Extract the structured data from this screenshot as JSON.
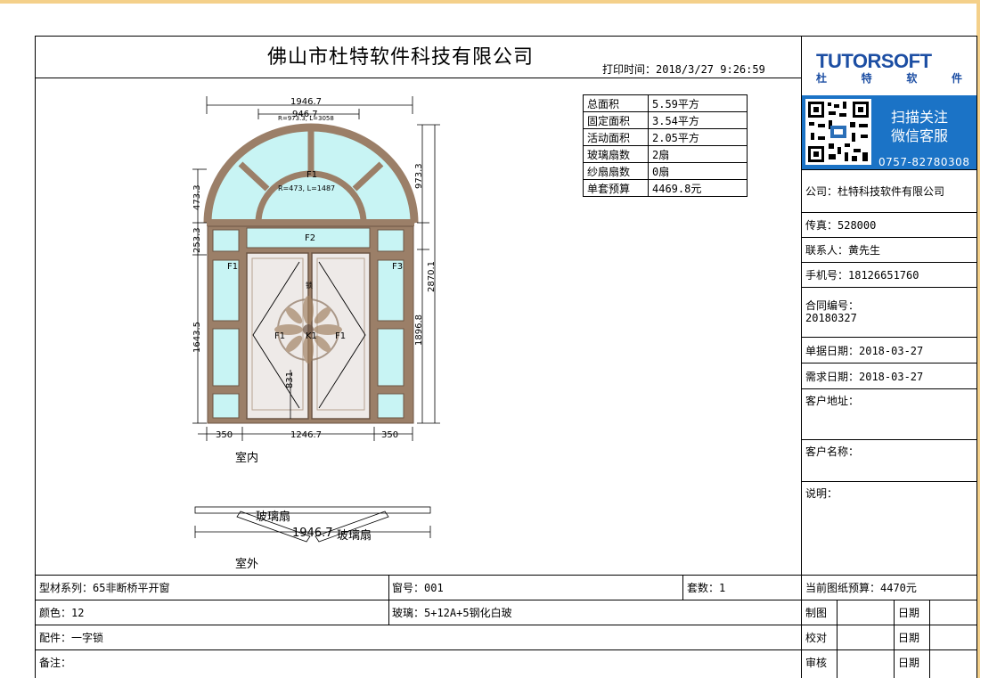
{
  "header": {
    "company_title": "佛山市杜特软件科技有限公司",
    "print_time": "打印时间：2018/3/27 9:26:59"
  },
  "logo": {
    "brand": "TUTORSOFT",
    "cn_chars": [
      "杜",
      "特",
      "软",
      "件"
    ]
  },
  "qr_panel": {
    "line1": "扫描关注",
    "line2": "微信客服",
    "phone": "0757-82780308"
  },
  "stats": [
    {
      "label": "总面积",
      "value": "5.59平方"
    },
    {
      "label": "固定面积",
      "value": "3.54平方"
    },
    {
      "label": "活动面积",
      "value": "2.05平方"
    },
    {
      "label": "玻璃扇数",
      "value": "2扇"
    },
    {
      "label": "纱扇扇数",
      "value": "0扇"
    },
    {
      "label": "单套预算",
      "value": "4469.8元"
    }
  ],
  "info": {
    "company": "公司：杜特科技软件有限公司",
    "fax": "传真：528000",
    "contact": "联系人：黄先生",
    "mobile": "手机号：18126651760",
    "contract_label": "合同编号：",
    "contract_no": "20180327",
    "doc_date": "单据日期：2018-03-27",
    "need_date": "需求日期：2018-03-27",
    "address": "客户地址：",
    "customer": "客户名称：",
    "notes": "说明："
  },
  "drawing": {
    "dim_top": "1946.7",
    "dim_top_inner": "946.7",
    "arc_label_outer": "R=973.3, L=3058",
    "arc_label_inner": "R=473, L=1487",
    "f1_top": "F1",
    "f2": "F2",
    "f1_left": "F1",
    "f3_right": "F3",
    "f1_leaf_left": "F1",
    "f1_leaf_right": "F1",
    "k1": "K1",
    "lock": "锁",
    "h_left_1": "473.3",
    "h_left_2": "253.3",
    "h_left_3": "1643.5",
    "h_right_1": "973.3",
    "h_right_2": "2870.1",
    "h_right_3": "1896.8",
    "handle_h": "831",
    "dim_b1": "350",
    "dim_b2": "1246.7",
    "dim_b3": "350",
    "indoor": "室内",
    "outdoor": "室外",
    "plan_dim": "1946.7",
    "plan_leaf_1": "玻璃扇",
    "plan_leaf_2": "玻璃扇"
  },
  "footer": {
    "series": "型材系列：65非断桥平开窗",
    "window_no": "窗号：001",
    "sets": "套数：1",
    "budget": "当前图纸预算：4470元",
    "color": "颜色：12",
    "glass": "玻璃：5+12A+5钢化白玻",
    "accessory": "配件：一字锁",
    "remark": "备注：",
    "draw": "制图",
    "check": "校对",
    "review": "审核",
    "date": "日期"
  },
  "colors": {
    "frame": "#9b7f68",
    "glass": "#c8f4f4",
    "door_glass": "#eeeae8",
    "qr_bg": "#1b73c6",
    "logo": "#1c4ea3"
  }
}
